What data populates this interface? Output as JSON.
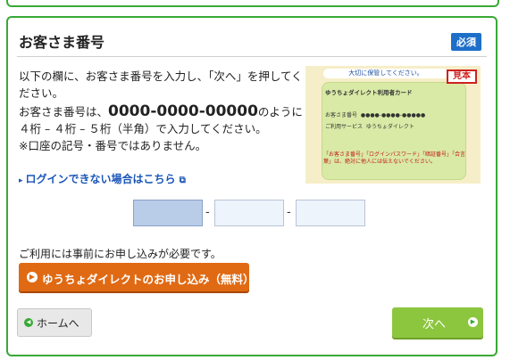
{
  "section": {
    "title": "お客さま番号",
    "required_badge": "必須"
  },
  "description": {
    "line1": "以下の欄に、お客さま番号を入力し、「次へ」を押してください。",
    "line2_prefix": "お客さま番号は、",
    "line2_number": "0000-0000-00000",
    "line2_suffix": "のように４桁 – ４桁 – ５桁（半角）で入力してください。",
    "line3": "※口座の記号・番号ではありません。"
  },
  "card_image": {
    "banner": "大切に保管してください。",
    "sample_label": "見本",
    "card_title": "ゆうちょダイレクト利用者カード",
    "number_label": "お客さま番号",
    "number_mask": "●●●●-●●●●-●●●●●",
    "service_label": "ご利用サービス",
    "service_value": "ゆうちょダイレクト",
    "warning": "「お客さま番号」「ログインパスワード」「暗証番号」「合言葉」は、絶対に他人には伝えないでください。"
  },
  "login_help": {
    "label": "ログインできない場合はこちら"
  },
  "number_input": {
    "separator": "-",
    "part1_value": "",
    "part2_value": "",
    "part3_value": ""
  },
  "notice": "ご利用には事前にお申し込みが必要です。",
  "apply_button": {
    "label": "ゆうちょダイレクトのお申し込み（無料）"
  },
  "home_button": {
    "label": "ホームへ"
  },
  "next_button": {
    "label": "次へ"
  },
  "colors": {
    "accent_green": "#39a935",
    "required_blue": "#1e6fc8",
    "apply_orange": "#e06a14",
    "next_green": "#8cc63f",
    "link_blue": "#1a56b8"
  }
}
